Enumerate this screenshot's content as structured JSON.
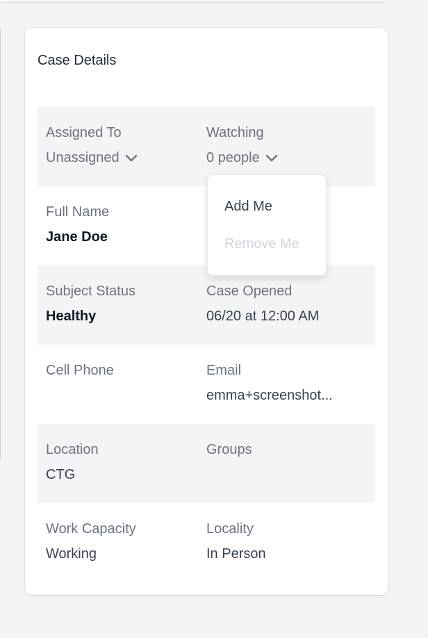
{
  "card": {
    "title": "Case Details",
    "fields": {
      "assigned_to": {
        "label": "Assigned To",
        "value": "Unassigned"
      },
      "watching": {
        "label": "Watching",
        "value": "0 people"
      },
      "full_name": {
        "label": "Full Name",
        "value": "Jane Doe"
      },
      "subject_status": {
        "label": "Subject Status",
        "value": "Healthy"
      },
      "case_opened": {
        "label": "Case Opened",
        "value": "06/20 at 12:00 AM"
      },
      "cell_phone": {
        "label": "Cell Phone",
        "value": ""
      },
      "email": {
        "label": "Email",
        "value": "emma+screenshot..."
      },
      "location": {
        "label": "Location",
        "value": "CTG"
      },
      "groups": {
        "label": "Groups",
        "value": ""
      },
      "work_capacity": {
        "label": "Work Capacity",
        "value": "Working"
      },
      "locality": {
        "label": "Locality",
        "value": "In Person"
      }
    }
  },
  "watch_menu": {
    "add_label": "Add Me",
    "remove_label": "Remove Me",
    "remove_disabled": true
  },
  "icons": {
    "dropdown": "chevron-down-icon"
  },
  "colors": {
    "page_bg": "#f3f4f6",
    "card_bg": "#ffffff",
    "row_shade": "#f3f4f6",
    "label": "#6b7280",
    "value": "#374151",
    "strong": "#111827",
    "disabled": "#d1d5db"
  }
}
